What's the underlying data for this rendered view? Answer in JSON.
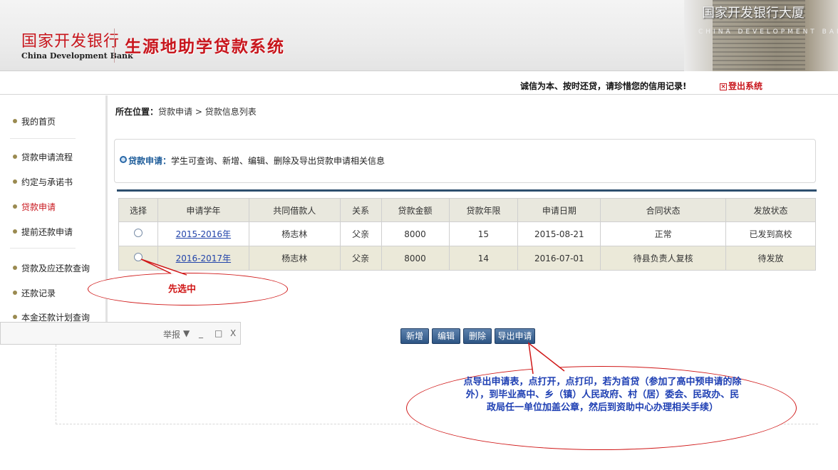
{
  "header": {
    "bank_name_cn": "国家开发银行",
    "bank_name_en": "China Development Bank",
    "system_title": "生源地助学贷款系统",
    "building_text": "国家开发银行大厦",
    "building_sub": "CHINA DEVELOPMENT BANK"
  },
  "notice": {
    "text": "诚信为本、按时还贷，请珍惜您的信用记录!",
    "logout_label": "登出系统",
    "logout_icon": "x-icon"
  },
  "sidebar": {
    "items": [
      {
        "label": "我的首页"
      },
      {
        "label": "贷款申请流程"
      },
      {
        "label": "约定与承诺书"
      },
      {
        "label": "贷款申请"
      },
      {
        "label": "提前还款申请"
      },
      {
        "label": "贷款及应还款查询"
      },
      {
        "label": "还款记录"
      },
      {
        "label": "本金还款计划查询"
      }
    ],
    "active_index": 3
  },
  "breadcrumb": {
    "prefix": "所在位置：",
    "path": "贷款申请 > 贷款信息列表"
  },
  "info": {
    "title": "贷款申请：",
    "text": "学生可查询、新增、编辑、删除及导出贷款申请相关信息"
  },
  "table": {
    "columns": [
      "选择",
      "申请学年",
      "共同借款人",
      "关系",
      "贷款金额",
      "贷款年限",
      "申请日期",
      "合同状态",
      "发放状态"
    ],
    "rows": [
      {
        "year": "2015-2016年",
        "co_borrower": "杨志林",
        "relation": "父亲",
        "amount": "8000",
        "term": "15",
        "date": "2015-08-21",
        "contract": "正常",
        "disburse": "已发到高校"
      },
      {
        "year": "2016-2017年",
        "co_borrower": "杨志林",
        "relation": "父亲",
        "amount": "8000",
        "term": "14",
        "date": "2016-07-01",
        "contract": "待县负责人复核",
        "disburse": "待发放"
      }
    ]
  },
  "minibar": {
    "report": "举报",
    "dropdown": "▼",
    "minimize": "_",
    "maximize": "□",
    "close": "X"
  },
  "buttons": {
    "add": "新增",
    "edit": "编辑",
    "delete": "删除",
    "export": "导出申请表"
  },
  "annotations": {
    "select_first": "先选中",
    "instructions": "点导出申请表，点打开，点打印，若为首贷（参加了高中预申请的除外），到毕业高中、乡（镇）人民政府、村（居）委会、民政办、民政局任一单位加盖公章，然后到资助中心办理相关手续）"
  },
  "colors": {
    "brand_red": "#c8161d",
    "button_blue": "#2d5584",
    "annotation_red": "#d01818",
    "annotation_blue": "#1e3fb3"
  }
}
